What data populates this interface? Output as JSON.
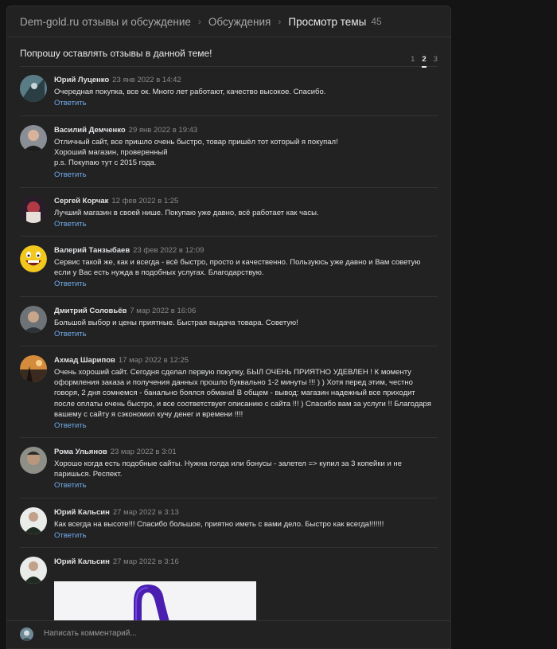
{
  "breadcrumb": {
    "site": "Dem-gold.ru отзывы и обсуждение",
    "section": "Обсуждения",
    "current": "Просмотр темы",
    "count": "45"
  },
  "topic": {
    "title": "Попрошу оставлять отзывы в данной теме!"
  },
  "pagination": {
    "pages": [
      "1",
      "2",
      "3"
    ],
    "active": "2"
  },
  "reply_label": "Ответить",
  "comments": [
    {
      "author": "Юрий Луценко",
      "date": "23 янв 2022 в 14:42",
      "lines": [
        "Очередная покупка, все ок. Много лет работают, качество высокое. Спасибо."
      ]
    },
    {
      "author": "Василий Демченко",
      "date": "29 янв 2022 в 19:43",
      "lines": [
        "Отличный сайт, все пришло очень быстро, товар пришёл тот который я покупал!",
        "Хороший магазин, проверенный",
        "p.s. Покупаю тут с 2015 года."
      ]
    },
    {
      "author": "Сергей Корчак",
      "date": "12 фев 2022 в 1:25",
      "lines": [
        "Лучший магазин в своей нише. Покупаю уже давно, всё работает как часы."
      ]
    },
    {
      "author": "Валерий Танзыбаев",
      "date": "23 фев 2022 в 12:09",
      "lines": [
        "Сервис такой же, как и всегда - всё быстро, просто и качественно. Пользуюсь уже давно и Вам советую",
        "если у Вас есть нужда в подобных услугах. Благодарствую."
      ]
    },
    {
      "author": "Дмитрий Соловьёв",
      "date": "7 мар 2022 в 16:06",
      "lines": [
        "Большой выбор и цены приятные. Быстрая выдача товара. Советую!"
      ]
    },
    {
      "author": "Ахмад Шарипов",
      "date": "17 мар 2022 в 12:25",
      "lines": [
        "Очень хороший сайт. Сегодня сделал первую покупку, БЫЛ ОЧЕНЬ ПРИЯТНО УДЕВЛЕН ! К моменту",
        "оформления заказа и получения данных прошло буквально 1-2 минуты !!! ) ) Хотя перед этим, честно",
        "говоря, 2 дня сомнемся - банально боялся обмана! В общем - вывод: магазин надежный все приходит",
        "после оплаты очень быстро, и все соответствует описанию с сайта !!! ) Спасибо вам за услуги !! Благодаря",
        "вашему с сайту я сэкономил кучу денег и времени !!!!"
      ]
    },
    {
      "author": "Рома Ульянов",
      "date": "23 мар 2022 в 3:01",
      "lines": [
        "Хорошо когда есть подобные сайты. Нужна голда или бонусы - залетел => купил за 3 копейки и не",
        "паришься. Респект."
      ]
    },
    {
      "author": "Юрий Кальсин",
      "date": "27 мар 2022 в 3:13",
      "lines": [
        "Как всегда на высоте!!! Спасибо большое, приятно иметь с вами дело. Быстро как всегда!!!!!!!"
      ]
    },
    {
      "author": "Юрий Кальсин",
      "date": "27 мар 2022 в 3:16",
      "lines": []
    }
  ],
  "comment_input": {
    "placeholder": "Написать комментарий..."
  },
  "colors": {
    "background": "#141414",
    "panel": "#222222",
    "link": "#71aaeb",
    "text": "#e1e3e6",
    "muted": "#8a8a8a"
  }
}
